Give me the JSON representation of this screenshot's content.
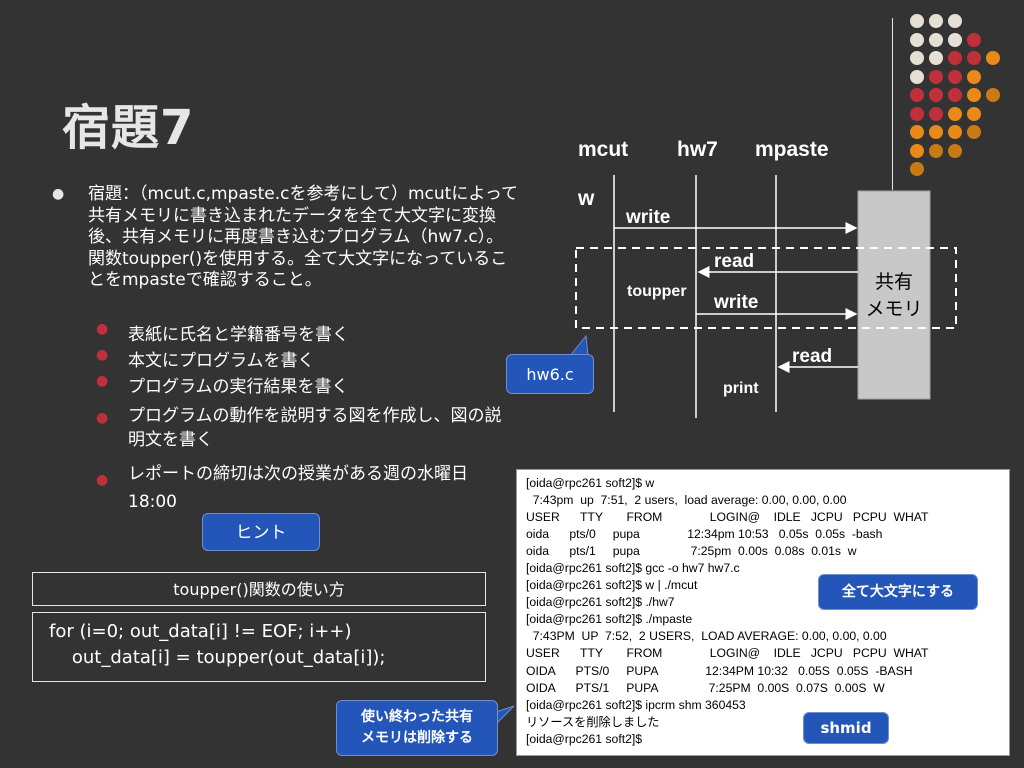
{
  "slide": {
    "title": "宿題7",
    "main_bullet": "宿題：（mcut.c,mpaste.cを参考にして）mcutによって共有メモリに書き込まれたデータを全て大文字に変換後、共有メモリに再度書き込むプログラム（hw7.c）。関数toupper()を使用する。全て大文字になっていることをmpasteで確認すること。",
    "sub_items": [
      "表紙に氏名と学籍番号を書く",
      "本文にプログラムを書く",
      "プログラムの実行結果を書く",
      "プログラムの動作を説明する図を作成し、図の説明文を書く",
      "レポートの締切は次の授業がある週の水曜日18:00"
    ]
  },
  "diagram": {
    "process_labels": [
      "mcut",
      "hw7",
      "mpaste"
    ],
    "w_label": "w",
    "write_label_1": "write",
    "read_label_1": "read",
    "toupper_label": "toupper",
    "write_label_2": "write",
    "read_label_2": "read",
    "print_label": "print",
    "shared_memory_label": [
      "共有",
      "メモリ"
    ],
    "hw6_label": "hw6.c"
  },
  "hint": {
    "label": "ヒント",
    "usage_title": "toupper()関数の使い方",
    "code_lines": [
      "for (i=0; out_data[i] != EOF; i++)",
      "    out_data[i] = toupper(out_data[i]);"
    ]
  },
  "terminal": {
    "lines": [
      "[oida@rpc261 soft2]$ w",
      "  7:43pm  up  7:51,  2 users,  load average: 0.00, 0.00, 0.00",
      "USER      TTY       FROM              LOGIN@    IDLE   JCPU   PCPU  WHAT",
      "oida      pts/0     pupa              12:34pm 10:53   0.05s  0.05s  -bash",
      "oida      pts/1     pupa               7:25pm  0.00s  0.08s  0.01s  w",
      "[oida@rpc261 soft2]$ gcc -o hw7 hw7.c",
      "[oida@rpc261 soft2]$ w | ./mcut",
      "[oida@rpc261 soft2]$ ./hw7",
      "[oida@rpc261 soft2]$ ./mpaste",
      "  7:43PM  UP  7:52,  2 USERS,  LOAD AVERAGE: 0.00, 0.00, 0.00",
      "USER      TTY       FROM              LOGIN@    IDLE   JCPU   PCPU  WHAT",
      "OIDA      PTS/0     PUPA              12:34PM 10:32   0.05S  0.05S  -BASH",
      "OIDA      PTS/1     PUPA               7:25PM  0.00S  0.07S  0.00S  W",
      "[oida@rpc261 soft2]$ ipcrm shm 360453",
      "リソースを削除しました",
      "[oida@rpc261 soft2]$"
    ]
  },
  "callouts": {
    "uppercase": "全て大文字にする",
    "shmid": "shmid",
    "delete": [
      "使い終わった共有",
      "メモリは削除する"
    ]
  },
  "colors": {
    "background": "#333333",
    "accent_red": "#c0303a",
    "accent_orange": "#e8891a",
    "callout_blue": "#2356b8"
  }
}
